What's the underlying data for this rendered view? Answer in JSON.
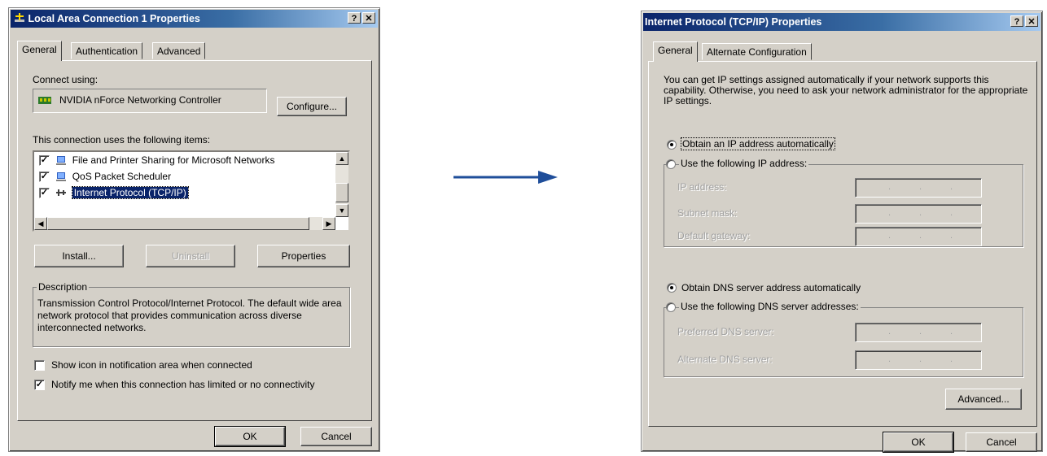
{
  "left_dialog": {
    "title": "Local Area Connection 1 Properties",
    "tabs": [
      "General",
      "Authentication",
      "Advanced"
    ],
    "connect_using_label": "Connect using:",
    "adapter_name": "NVIDIA nForce Networking Controller",
    "configure_label": "Configure...",
    "items_label": "This connection uses the following items:",
    "items": [
      {
        "label": "File and Printer Sharing for Microsoft Networks",
        "checked": true
      },
      {
        "label": "QoS Packet Scheduler",
        "checked": true
      },
      {
        "label": "Internet Protocol (TCP/IP)",
        "checked": true
      }
    ],
    "install_label": "Install...",
    "uninstall_label": "Uninstall",
    "properties_label": "Properties",
    "description_title": "Description",
    "description_text": "Transmission Control Protocol/Internet Protocol. The default wide area network protocol that provides communication across diverse interconnected networks.",
    "show_icon_label": "Show icon in notification area when connected",
    "notify_label": "Notify me when this connection has limited or no connectivity",
    "ok_label": "OK",
    "cancel_label": "Cancel",
    "help_glyph": "?",
    "close_glyph": "✕"
  },
  "arrow": {
    "color": "#1f4e9a"
  },
  "right_dialog": {
    "title": "Internet Protocol (TCP/IP) Properties",
    "tabs": [
      "General",
      "Alternate Configuration"
    ],
    "intro_text": "You can get IP settings assigned automatically if your network supports this capability. Otherwise, you need to ask your network administrator for the appropriate IP settings.",
    "obtain_ip_label": "Obtain an IP address automatically",
    "use_ip_label": "Use the following IP address:",
    "ip_address_label": "IP address:",
    "subnet_label": "Subnet mask:",
    "gateway_label": "Default gateway:",
    "obtain_dns_label": "Obtain DNS server address automatically",
    "use_dns_label": "Use the following DNS server addresses:",
    "preferred_dns_label": "Preferred DNS server:",
    "alternate_dns_label": "Alternate DNS server:",
    "advanced_label": "Advanced...",
    "ok_label": "OK",
    "cancel_label": "Cancel",
    "help_glyph": "?",
    "close_glyph": "✕"
  }
}
